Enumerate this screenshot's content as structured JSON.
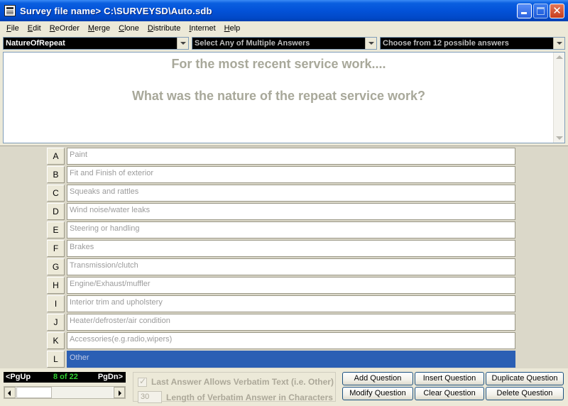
{
  "window": {
    "title": "Survey file name> C:\\SURVEYSD\\Auto.sdb",
    "close_glyph": "✕"
  },
  "menu": {
    "items": [
      {
        "label": "File",
        "accel": "F",
        "rest": "ile"
      },
      {
        "label": "Edit",
        "accel": "E",
        "rest": "dit"
      },
      {
        "label": "ReOrder",
        "accel": "R",
        "rest": "eOrder"
      },
      {
        "label": "Merge",
        "accel": "M",
        "rest": "erge"
      },
      {
        "label": "Clone",
        "accel": "C",
        "rest": "lone"
      },
      {
        "label": "Distribute",
        "accel": "D",
        "rest": "istribute"
      },
      {
        "label": "Internet",
        "accel": "I",
        "rest": "nternet"
      },
      {
        "label": "Help",
        "accel": "H",
        "rest": "elp"
      }
    ]
  },
  "selectors": {
    "question_name": "NatureOfRepeat",
    "answer_mode": "Select Any of Multiple Answers",
    "answer_count": "Choose from 12 possible answers"
  },
  "question": {
    "line1": "For the most recent service work....",
    "line2": "What was the nature of the repeat service work?"
  },
  "answers": [
    {
      "letter": "A",
      "text": "Paint"
    },
    {
      "letter": "B",
      "text": "Fit and Finish of exterior"
    },
    {
      "letter": "C",
      "text": "Squeaks and rattles"
    },
    {
      "letter": "D",
      "text": "Wind noise/water leaks"
    },
    {
      "letter": "E",
      "text": "Steering or handling"
    },
    {
      "letter": "F",
      "text": "Brakes"
    },
    {
      "letter": "G",
      "text": "Transmission/clutch"
    },
    {
      "letter": "H",
      "text": "Engine/Exhaust/muffler"
    },
    {
      "letter": "I",
      "text": "Interior trim and upholstery"
    },
    {
      "letter": "J",
      "text": "Heater/defroster/air condition"
    },
    {
      "letter": "K",
      "text": "Accessories(e.g.radio,wipers)"
    },
    {
      "letter": "L",
      "text": "Other",
      "selected": true
    }
  ],
  "pager": {
    "pgup": "<PgUp",
    "count": "8 of   22",
    "pgdn": "PgDn>"
  },
  "verbatim": {
    "checkbox_label": "Last Answer Allows Verbatim Text (i.e. Other)",
    "checked": true,
    "length_value": "30",
    "length_label": "Length of Verbatim Answer in Characters"
  },
  "buttons": {
    "add": "Add Question",
    "insert": "Insert Question",
    "duplicate": "Duplicate Question",
    "modify": "Modify Question",
    "clear": "Clear Question",
    "delete": "Delete Question"
  },
  "colors": {
    "selected_answer_bg": "#2b5fb4",
    "pager_count": "#2fd12f",
    "title_bar": "#0352d8"
  }
}
